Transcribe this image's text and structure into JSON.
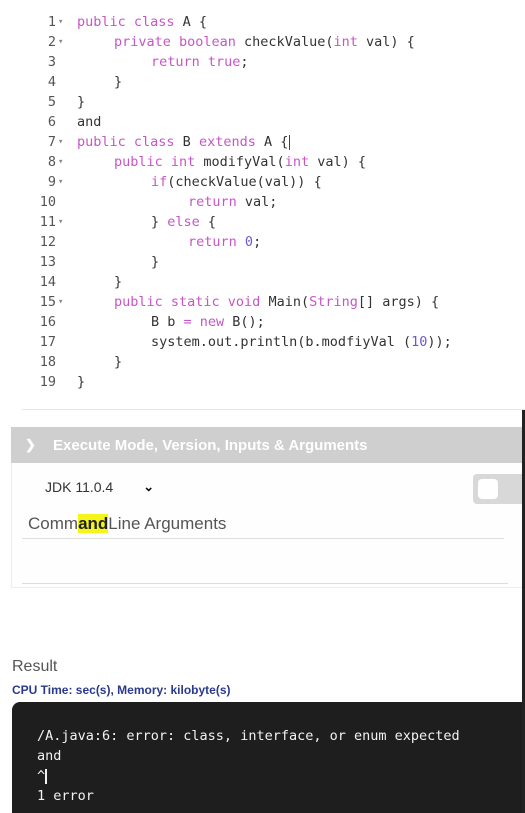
{
  "editor": {
    "lines": [
      {
        "num": "1",
        "fold": true,
        "indent": 0,
        "tokens": [
          {
            "t": "public class",
            "c": "kw"
          },
          {
            "t": " A {",
            "c": ""
          }
        ]
      },
      {
        "num": "2",
        "fold": true,
        "indent": 1,
        "tokens": [
          {
            "t": "private boolean",
            "c": "kw"
          },
          {
            "t": " checkValue(",
            "c": ""
          },
          {
            "t": "int",
            "c": "kw"
          },
          {
            "t": " val) {",
            "c": ""
          }
        ]
      },
      {
        "num": "3",
        "fold": false,
        "indent": 2,
        "tokens": [
          {
            "t": "return true",
            "c": "kw"
          },
          {
            "t": ";",
            "c": ""
          }
        ]
      },
      {
        "num": "4",
        "fold": false,
        "indent": 1,
        "tokens": [
          {
            "t": "}",
            "c": ""
          }
        ]
      },
      {
        "num": "5",
        "fold": false,
        "indent": 0,
        "tokens": [
          {
            "t": "}",
            "c": ""
          }
        ]
      },
      {
        "num": "6",
        "fold": false,
        "indent": 0,
        "tokens": [
          {
            "t": "and",
            "c": ""
          }
        ]
      },
      {
        "num": "7",
        "fold": true,
        "indent": 0,
        "tokens": [
          {
            "t": "public class",
            "c": "kw"
          },
          {
            "t": " B ",
            "c": ""
          },
          {
            "t": "extends",
            "c": "kw"
          },
          {
            "t": " A {",
            "c": ""
          }
        ],
        "cursor": true
      },
      {
        "num": "8",
        "fold": true,
        "indent": 1,
        "tokens": [
          {
            "t": "public int",
            "c": "kw"
          },
          {
            "t": " modifyVal(",
            "c": ""
          },
          {
            "t": "int",
            "c": "kw"
          },
          {
            "t": " val) {",
            "c": ""
          }
        ]
      },
      {
        "num": "9",
        "fold": true,
        "indent": 2,
        "tokens": [
          {
            "t": "if",
            "c": "kw"
          },
          {
            "t": "(checkValue(val)) {",
            "c": ""
          }
        ]
      },
      {
        "num": "10",
        "fold": false,
        "indent": 3,
        "tokens": [
          {
            "t": "return",
            "c": "kw"
          },
          {
            "t": " val;",
            "c": ""
          }
        ]
      },
      {
        "num": "11",
        "fold": true,
        "indent": 2,
        "tokens": [
          {
            "t": "} ",
            "c": ""
          },
          {
            "t": "else",
            "c": "kw"
          },
          {
            "t": " {",
            "c": ""
          }
        ]
      },
      {
        "num": "12",
        "fold": false,
        "indent": 3,
        "tokens": [
          {
            "t": "return",
            "c": "kw"
          },
          {
            "t": " ",
            "c": ""
          },
          {
            "t": "0",
            "c": "num"
          },
          {
            "t": ";",
            "c": ""
          }
        ]
      },
      {
        "num": "13",
        "fold": false,
        "indent": 2,
        "tokens": [
          {
            "t": "}",
            "c": ""
          }
        ]
      },
      {
        "num": "14",
        "fold": false,
        "indent": 1,
        "tokens": [
          {
            "t": "}",
            "c": ""
          }
        ]
      },
      {
        "num": "15",
        "fold": true,
        "indent": 1,
        "tokens": [
          {
            "t": "public static void",
            "c": "kw"
          },
          {
            "t": " Main(",
            "c": ""
          },
          {
            "t": "String",
            "c": "kw"
          },
          {
            "t": "[] args) {",
            "c": ""
          }
        ]
      },
      {
        "num": "16",
        "fold": false,
        "indent": 2,
        "tokens": [
          {
            "t": "B b ",
            "c": ""
          },
          {
            "t": "= new",
            "c": "kw"
          },
          {
            "t": " B();",
            "c": ""
          }
        ]
      },
      {
        "num": "17",
        "fold": false,
        "indent": 2,
        "tokens": [
          {
            "t": "system.out.println(b.modfiyVal (",
            "c": ""
          },
          {
            "t": "10",
            "c": "num"
          },
          {
            "t": "));",
            "c": ""
          }
        ]
      },
      {
        "num": "18",
        "fold": false,
        "indent": 1,
        "tokens": [
          {
            "t": "}",
            "c": ""
          }
        ]
      },
      {
        "num": "19",
        "fold": false,
        "indent": 0,
        "tokens": [
          {
            "t": "}",
            "c": ""
          }
        ]
      }
    ]
  },
  "execute_panel": {
    "header": "Execute Mode, Version, Inputs & Arguments",
    "header_icon": "chevron-down-icon",
    "jdk_version": "JDK 11.0.4",
    "select_icon": "chevron-down-icon",
    "interactive_toggle": false,
    "cmd_label_prefix": "Comm",
    "cmd_label_highlight": "and",
    "cmd_label_suffix": "Line Arguments",
    "cmd_value": ""
  },
  "result": {
    "title": "Result",
    "stats": "CPU Time: sec(s), Memory: kilobyte(s)",
    "output_lines": [
      "/A.java:6: error: class, interface, or enum expected",
      "and",
      "^",
      "1 error"
    ]
  },
  "colors": {
    "keyword": "#c855c8",
    "number": "#6a5acd",
    "accordion_bg": "#cfcfcf",
    "highlight": "#f5f51a",
    "stats_text": "#2a3a8c",
    "terminal_bg": "#1e1e1e"
  }
}
